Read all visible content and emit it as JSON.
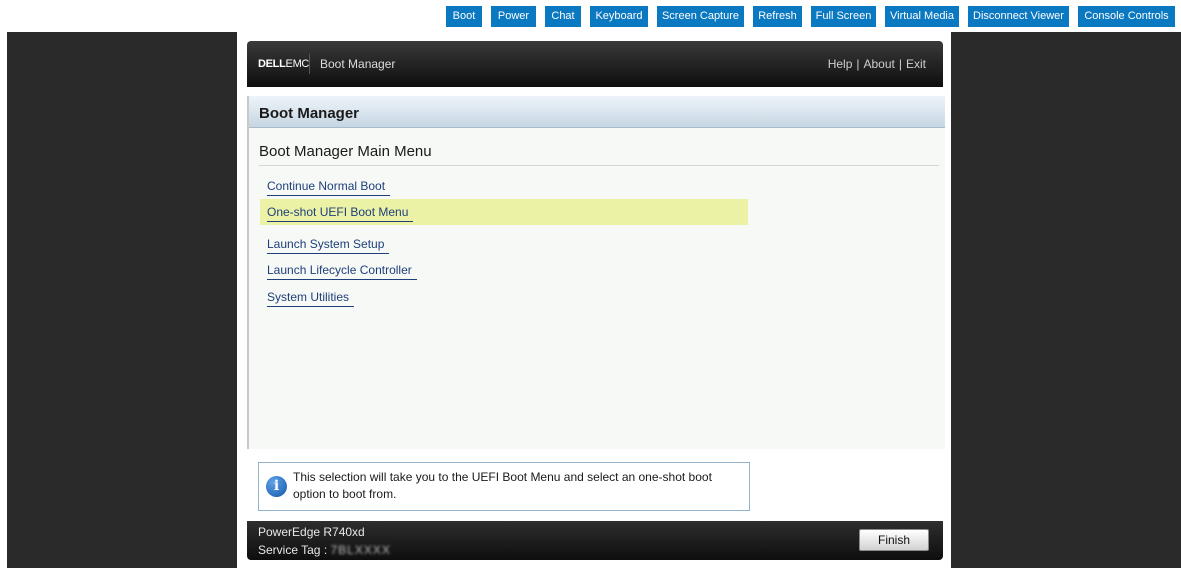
{
  "viewer_toolbar": {
    "buttons": [
      {
        "label": "Boot"
      },
      {
        "label": "Power"
      },
      {
        "label": "Chat"
      },
      {
        "label": "Keyboard"
      },
      {
        "label": "Screen Capture"
      },
      {
        "label": "Refresh"
      },
      {
        "label": "Full Screen"
      },
      {
        "label": "Virtual Media"
      },
      {
        "label": "Disconnect Viewer"
      },
      {
        "label": "Console Controls"
      }
    ],
    "accent_color": "#0b78c2"
  },
  "bios": {
    "header": {
      "brand": "DELL",
      "brand_suffix": "EMC",
      "title": "Boot Manager",
      "links": [
        "Help",
        "About",
        "Exit"
      ],
      "link_separator": "|"
    },
    "panel_title": "Boot Manager",
    "menu_heading": "Boot Manager Main Menu",
    "menu_items": [
      {
        "label": "Continue Normal Boot",
        "selected": false
      },
      {
        "label": "One-shot UEFI Boot Menu",
        "selected": true
      },
      {
        "label": "Launch System Setup",
        "selected": false
      },
      {
        "label": "Launch Lifecycle Controller",
        "selected": false
      },
      {
        "label": "System Utilities",
        "selected": false
      }
    ],
    "help": {
      "icon": "info-icon",
      "icon_glyph": "i",
      "text": "This selection will take you to the UEFI Boot Menu and select an one-shot boot option to boot from."
    },
    "footer": {
      "model": "PowerEdge R740xd",
      "service_tag_label": "Service Tag :",
      "service_tag_value": "7BLXXXX",
      "finish_label": "Finish"
    },
    "highlight_color": "#ebf2a6"
  }
}
